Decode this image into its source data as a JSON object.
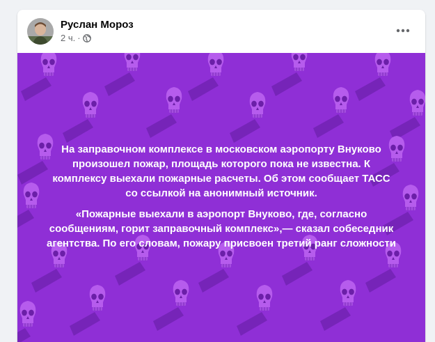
{
  "post": {
    "author_name": "Руслан Мороз",
    "timestamp": "2 ч.",
    "separator": "·",
    "privacy_icon": "globe-icon",
    "more_icon": "more-options-icon",
    "paragraph_1": "На заправочном комплексе в московском аэропорту Внуково произошел пожар, площадь которого пока не известна. К комплексу выехали пожарные расчеты. Об этом сообщает ТАСС со ссылкой на анонимный источник.",
    "paragraph_2": "«Пожарные выехали в аэропорт Внуково, где, согласно сообщениям, горит заправочный комплекс»,— сказал собеседник агентства. По его словам, пожару присвоен третий ранг сложности"
  },
  "colors": {
    "background": "#8f2fd6",
    "skull": "#b85ff0",
    "shadow": "#6b1fa8",
    "text": "#ffffff"
  }
}
